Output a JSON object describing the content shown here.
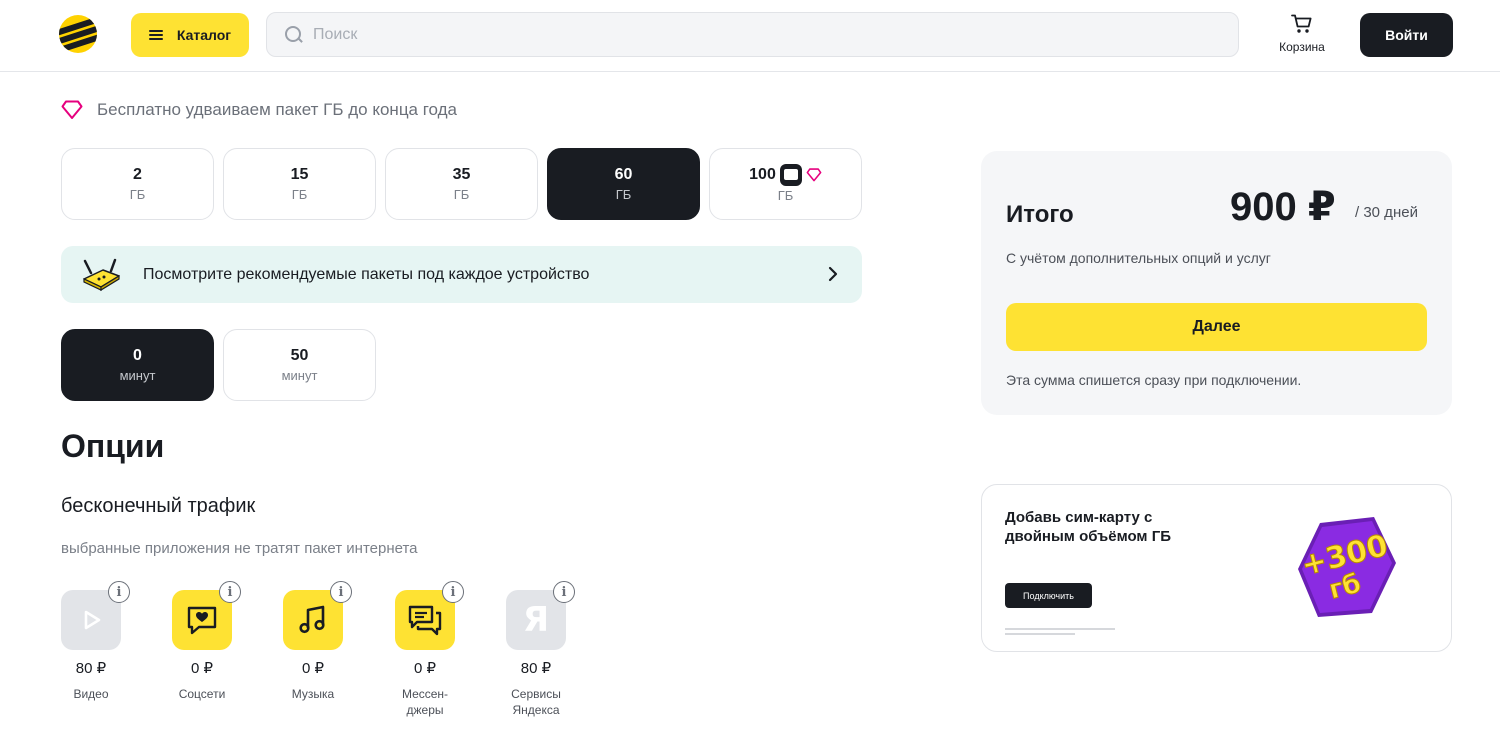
{
  "header": {
    "catalog_label": "Каталог",
    "search_placeholder": "Поиск",
    "cart_label": "Корзина",
    "login_label": "Войти"
  },
  "promo": {
    "text": "Бесплатно удваиваем пакет ГБ до конца года"
  },
  "gb_options": [
    {
      "value": "2",
      "unit": "ГБ",
      "selected": false
    },
    {
      "value": "15",
      "unit": "ГБ",
      "selected": false
    },
    {
      "value": "35",
      "unit": "ГБ",
      "selected": false
    },
    {
      "value": "60",
      "unit": "ГБ",
      "selected": true
    },
    {
      "value": "100",
      "unit": "ГБ",
      "selected": false
    }
  ],
  "device_banner": {
    "text": "Посмотрите рекомендуемые пакеты под каждое устройство"
  },
  "minutes_options": [
    {
      "value": "0",
      "unit": "минут",
      "selected": true
    },
    {
      "value": "50",
      "unit": "минут",
      "selected": false
    }
  ],
  "options": {
    "title": "Опции",
    "subtitle": "бесконечный трафик",
    "description": "выбранные приложения не тратят пакет интернета",
    "apps": [
      {
        "name": "Видео",
        "price": "80 ₽",
        "icon": "video-play-icon",
        "style": "gray"
      },
      {
        "name": "Соцсети",
        "price": "0 ₽",
        "icon": "heart-chat-icon",
        "style": "yellow"
      },
      {
        "name": "Музыка",
        "price": "0 ₽",
        "icon": "music-note-icon",
        "style": "yellow"
      },
      {
        "name": "Мессен-\nджеры",
        "price": "0 ₽",
        "icon": "messages-icon",
        "style": "yellow"
      },
      {
        "name": "Сервисы\nЯндекса",
        "price": "80 ₽",
        "icon": "yandex-icon",
        "style": "gray"
      }
    ]
  },
  "summary": {
    "title": "Итого",
    "price": "900 ₽",
    "period": "/ 30 дней",
    "note": "С учётом дополнительных опций и услуг",
    "next_label": "Далее",
    "footer": "Эта сумма спишется сразу при подключении."
  },
  "ad": {
    "title": "Добавь сим-карту с двойным объёмом ГБ",
    "button_label": "Подключить",
    "art_text": "+300 гб"
  },
  "colors": {
    "brand_yellow": "#fee233",
    "dark": "#191c22",
    "accent_pink": "#e6007e",
    "banner_bg": "#e6f5f3"
  }
}
